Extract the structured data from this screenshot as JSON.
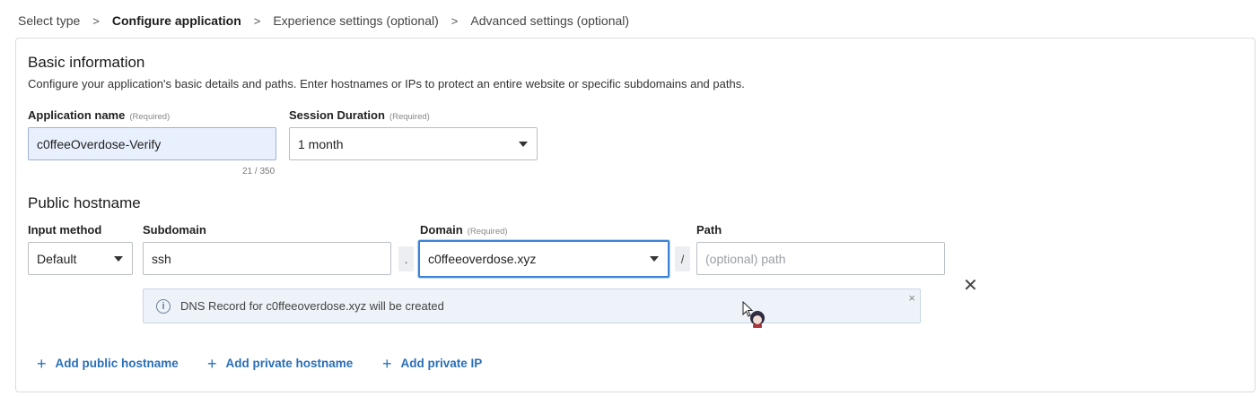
{
  "breadcrumb": {
    "steps": [
      "Select type",
      "Configure application",
      "Experience settings (optional)",
      "Advanced settings (optional)"
    ],
    "separator": ">"
  },
  "basic": {
    "title": "Basic information",
    "description": "Configure your application's basic details and paths. Enter hostnames or IPs to protect an entire website or specific subdomains and paths.",
    "app_name_label": "Application name",
    "app_name_required": "(Required)",
    "app_name_value": "c0ffeeOverdose-Verify",
    "app_name_counter": "21 / 350",
    "session_label": "Session Duration",
    "session_required": "(Required)",
    "session_value": "1 month"
  },
  "public": {
    "title": "Public hostname",
    "input_method_label": "Input method",
    "input_method_value": "Default",
    "subdomain_label": "Subdomain",
    "subdomain_value": "ssh",
    "dot": ".",
    "domain_label": "Domain",
    "domain_required": "(Required)",
    "domain_value": "c0ffeeoverdose.xyz",
    "slash": "/",
    "path_label": "Path",
    "path_placeholder": "(optional) path",
    "remove": "✕",
    "info_icon": "i",
    "info_message": "DNS Record for c0ffeeoverdose.xyz will be created",
    "info_dismiss": "×"
  },
  "actions": {
    "plus": "+",
    "add_public": "Add public hostname",
    "add_private": "Add private hostname",
    "add_ip": "Add private IP"
  },
  "colors": {
    "accent": "#2a6fb8",
    "focus_border": "#3b82d6",
    "filled_bg": "#e8f0fe",
    "info_bg": "#edf3f9"
  }
}
